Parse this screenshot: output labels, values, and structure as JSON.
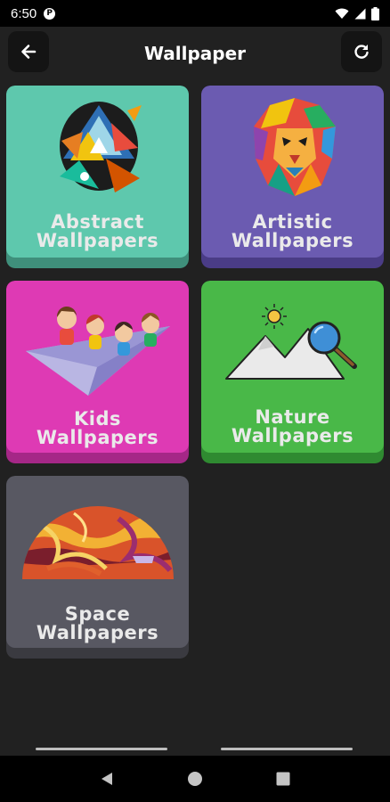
{
  "status_bar": {
    "time": "6:50",
    "app_icon_letter": "P"
  },
  "app_bar": {
    "title": "Wallpaper",
    "back_icon": "arrow-left-icon",
    "refresh_icon": "refresh-icon"
  },
  "cards": [
    {
      "line1": "Abstract",
      "line2": "Wallpapers",
      "color": "#5ec8ad",
      "shadow": "#3f8f7b",
      "image": "abstract-art-image"
    },
    {
      "line1": "Artistic",
      "line2": "Wallpapers",
      "color": "#6b5bb1",
      "shadow": "#4a3c86",
      "image": "colorful-lion-image"
    },
    {
      "line1": "Kids",
      "line2": "Wallpapers",
      "color": "#de3ab4",
      "shadow": "#a52787",
      "image": "kids-paper-plane-image"
    },
    {
      "line1": "Nature",
      "line2": "Wallpapers",
      "color": "#49b848",
      "shadow": "#2f8a31",
      "image": "mountain-search-image"
    },
    {
      "line1": "Space",
      "line2": "Wallpapers",
      "color": "#585862",
      "shadow": "#3a3a40",
      "image": "space-planet-image"
    }
  ],
  "nav_bar": {
    "back": "back-triangle-icon",
    "home": "home-circle-icon",
    "recents": "recents-square-icon"
  }
}
